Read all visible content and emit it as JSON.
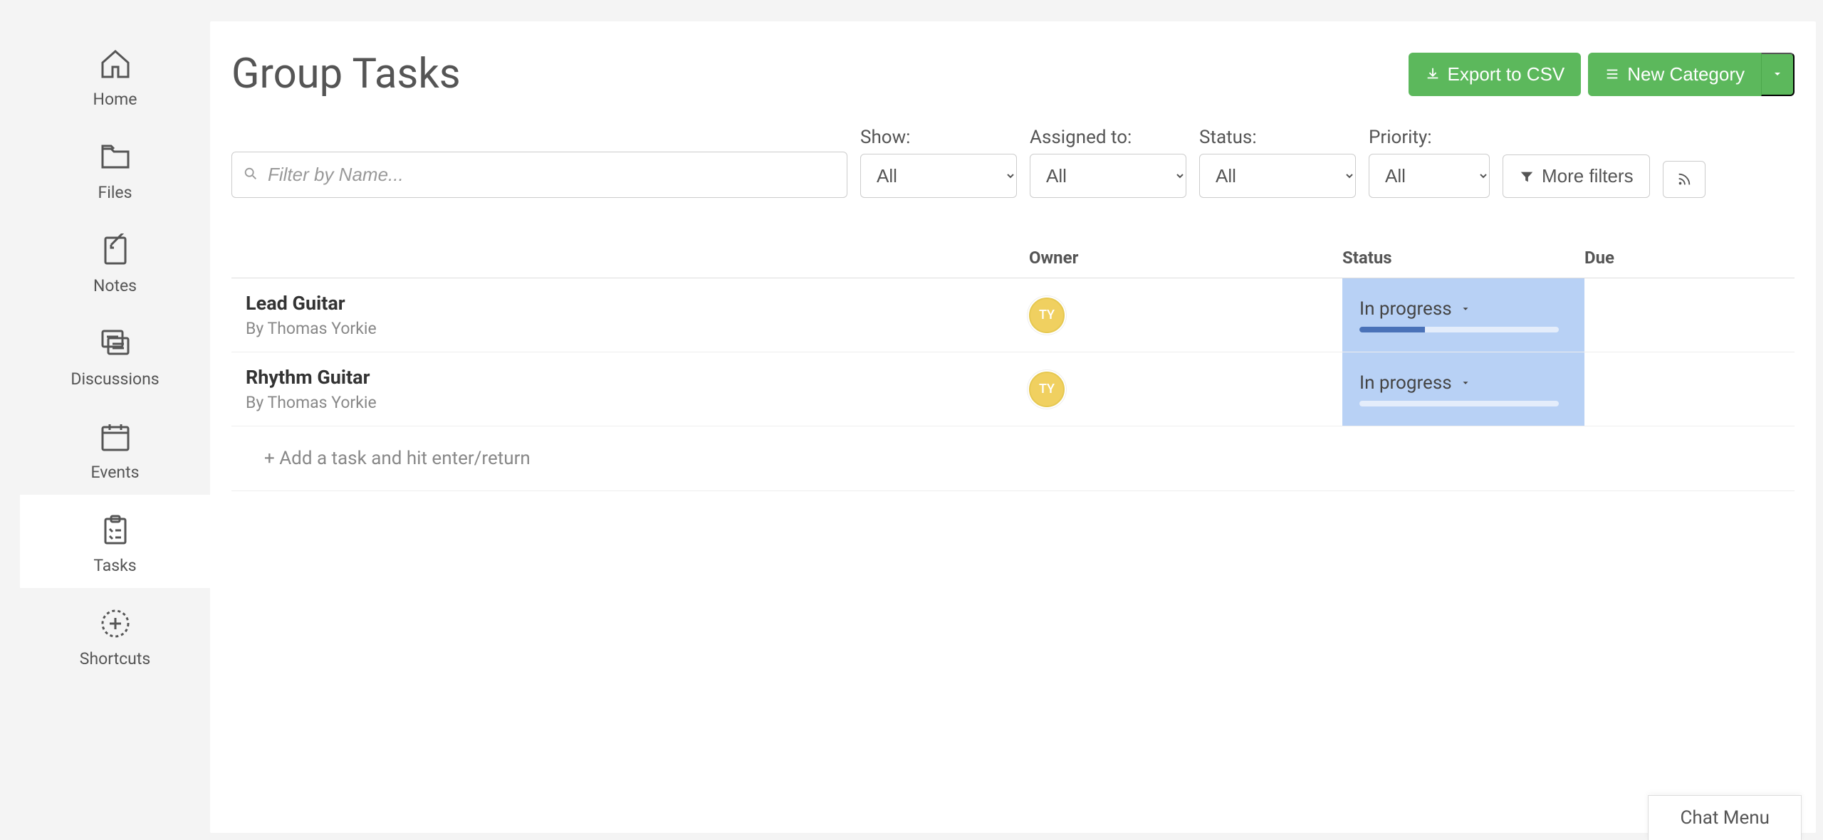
{
  "sidebar": {
    "items": [
      {
        "label": "Home"
      },
      {
        "label": "Files"
      },
      {
        "label": "Notes"
      },
      {
        "label": "Discussions"
      },
      {
        "label": "Events"
      },
      {
        "label": "Tasks"
      },
      {
        "label": "Shortcuts"
      }
    ]
  },
  "header": {
    "title": "Group Tasks",
    "export_label": "Export to CSV",
    "new_category_label": "New Category"
  },
  "filters": {
    "search_placeholder": "Filter by Name...",
    "show": {
      "label": "Show:",
      "value": "All"
    },
    "assigned": {
      "label": "Assigned to:",
      "value": "All"
    },
    "status": {
      "label": "Status:",
      "value": "All"
    },
    "priority": {
      "label": "Priority:",
      "value": "All"
    },
    "more_label": "More filters"
  },
  "table": {
    "columns": {
      "owner": "Owner",
      "status": "Status",
      "due": "Due"
    },
    "rows": [
      {
        "title": "Lead Guitar",
        "by": "By Thomas Yorkie",
        "owner_initials": "TY",
        "status": "In progress",
        "progress": 33
      },
      {
        "title": "Rhythm Guitar",
        "by": "By Thomas Yorkie",
        "owner_initials": "TY",
        "status": "In progress",
        "progress": 0
      }
    ],
    "add_placeholder": "+ Add a task and hit enter/return"
  },
  "chat": {
    "label": "Chat Menu"
  }
}
